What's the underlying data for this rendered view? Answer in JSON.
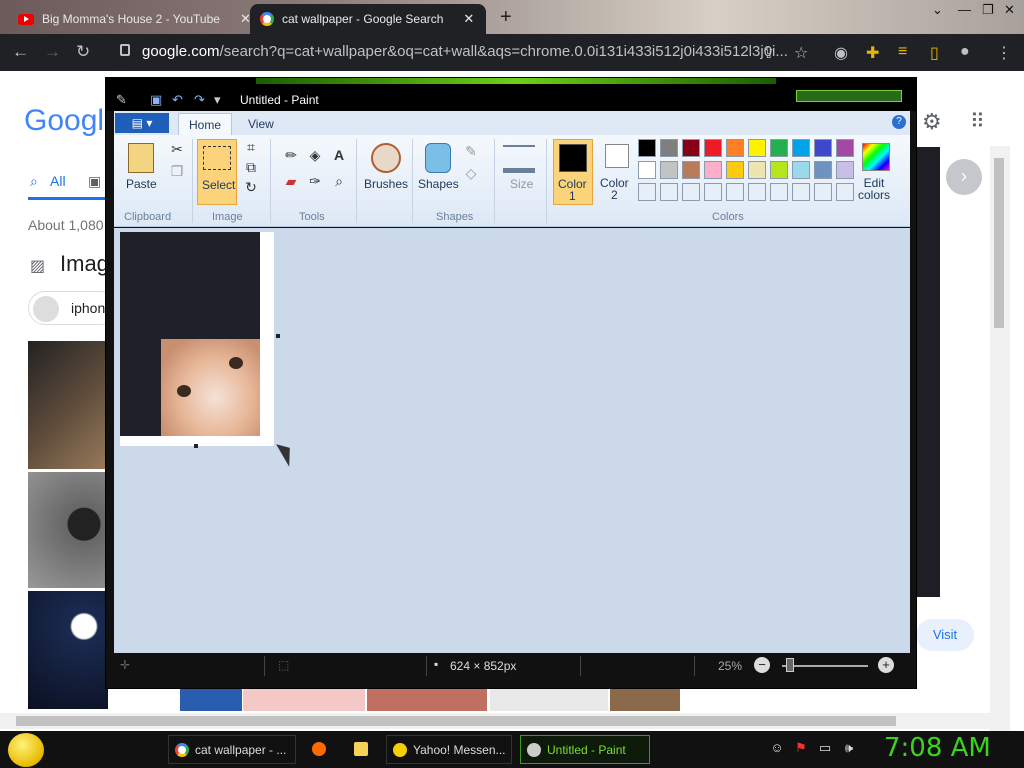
{
  "browser": {
    "tabs": [
      {
        "title": "Big Momma's House 2 - YouTube",
        "icon": "youtube-icon"
      },
      {
        "title": "cat wallpaper - Google Search",
        "icon": "google-icon",
        "active": true
      }
    ],
    "url_domain": "google.com",
    "url_rest": "/search?q=cat+wallpaper&oq=cat+wall&aqs=chrome.0.0i131i433i512j0i433i512l3j0i..."
  },
  "google": {
    "logo": "Google",
    "tabs": [
      "All"
    ],
    "results_count": "About 1,080",
    "images_heading": "Imag",
    "chip_label": "iphon",
    "visit": "Visit"
  },
  "paint": {
    "title": "Untitled - Paint",
    "tabs": [
      "Home",
      "View"
    ],
    "groups": [
      "Clipboard",
      "Image",
      "Tools",
      "Shapes",
      "Colors"
    ],
    "buttons": {
      "paste": "Paste",
      "select": "Select",
      "brushes": "Brushes",
      "shapes": "Shapes",
      "size": "Size",
      "color1": "Color\n1",
      "color2": "Color\n2",
      "edit_colors": "Edit\ncolors"
    },
    "palette_row1": [
      "#000000",
      "#7f7f7f",
      "#880015",
      "#ed1c24",
      "#ff7f27",
      "#fff200",
      "#22b14c",
      "#00a2e8",
      "#3f48cc",
      "#a349a4"
    ],
    "palette_row2": [
      "#ffffff",
      "#c3c3c3",
      "#b97a57",
      "#ffaec9",
      "#ffc90e",
      "#efe4b0",
      "#b5e61d",
      "#99d9ea",
      "#7092be",
      "#c8bfe7"
    ],
    "status": {
      "dimensions": "624 × 852px",
      "zoom": "25%"
    }
  },
  "taskbar": {
    "items": [
      {
        "label": "cat wallpaper - ...",
        "icon": "chrome-icon"
      },
      {
        "label": "",
        "icon": "firefox-icon"
      },
      {
        "label": "",
        "icon": "folder-icon"
      },
      {
        "label": "Yahoo! Messen...",
        "icon": "yahoo-messenger-icon"
      },
      {
        "label": "Untitled - Paint",
        "icon": "paint-icon",
        "active": true
      }
    ],
    "clock": "7:08 AM"
  }
}
